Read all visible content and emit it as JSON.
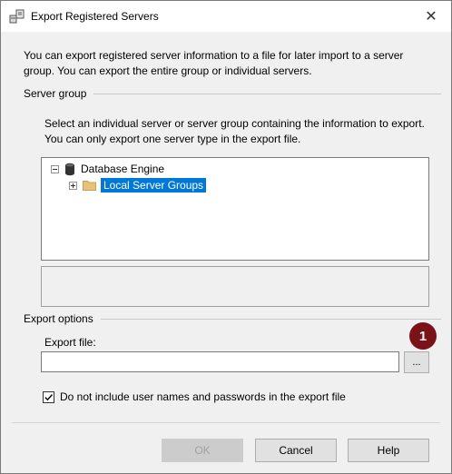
{
  "window": {
    "title": "Export Registered Servers",
    "close_glyph": "✕"
  },
  "intro_text": "You can export registered server information to a file for later import to a server group. You can export the entire group or individual servers.",
  "server_group": {
    "label": "Server group",
    "description": "Select an individual server or server group containing the information to export. You can only export one server type in the export file.",
    "tree": {
      "root": {
        "label": "Database Engine",
        "icon": "database-icon",
        "expanded": true
      },
      "child": {
        "label": "Local Server Groups",
        "icon": "folder-icon",
        "expanded": false,
        "selected": true
      }
    }
  },
  "export_options": {
    "label": "Export options",
    "file_label": "Export file:",
    "file_value": "",
    "browse_label": "...",
    "callout_number": "1",
    "checkbox_label": "Do not include user names and passwords in the export file",
    "checkbox_checked": true
  },
  "buttons": {
    "ok": "OK",
    "cancel": "Cancel",
    "help": "Help"
  },
  "colors": {
    "selection": "#0078d7",
    "callout": "#7a1218",
    "dialog_bg": "#f0f0f0"
  }
}
